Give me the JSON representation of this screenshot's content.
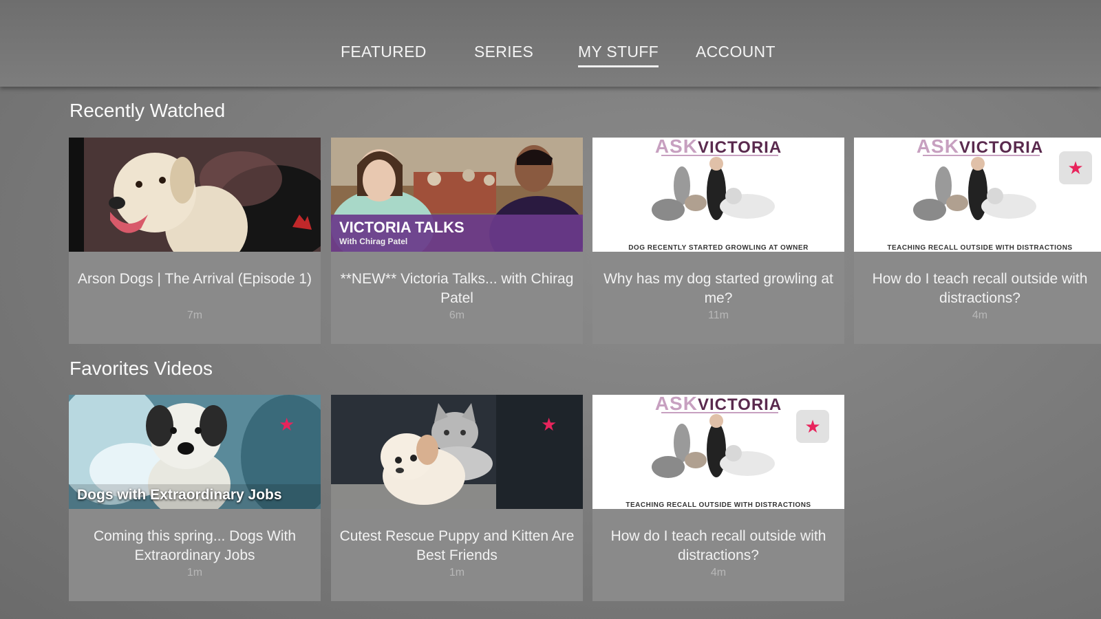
{
  "nav": {
    "tabs": [
      {
        "label": "FEATURED",
        "active": false
      },
      {
        "label": "SERIES",
        "active": false
      },
      {
        "label": "MY STUFF",
        "active": true
      },
      {
        "label": "ACCOUNT",
        "active": false
      }
    ]
  },
  "recently_watched": {
    "title": "Recently Watched",
    "items": [
      {
        "title": "Arson Dogs | The Arrival (Episode 1)",
        "duration": "7m",
        "thumbnail": "labrador-photo"
      },
      {
        "title": "**NEW** Victoria Talks... with Chirag Patel",
        "duration": "6m",
        "thumbnail": "victoria-talks",
        "overlay_title": "VICTORIA TALKS",
        "overlay_subtitle": "With Chirag Patel"
      },
      {
        "title": "Why has my dog started growling at me?",
        "duration": "11m",
        "thumbnail": "ask-victoria",
        "overlay_ask": "ASK",
        "overlay_victoria": "VICTORIA",
        "overlay_caption": "DOG RECENTLY STARTED GROWLING AT OWNER"
      },
      {
        "title": "How do I teach recall outside with distractions?",
        "duration": "4m",
        "thumbnail": "ask-victoria",
        "favorited": true,
        "overlay_ask": "ASK",
        "overlay_victoria": "VICTORIA",
        "overlay_caption": "TEACHING RECALL OUTSIDE WITH DISTRACTIONS"
      }
    ]
  },
  "favorites": {
    "title": "Favorites Videos",
    "items": [
      {
        "title": "Coming this spring... Dogs With Extraordinary Jobs",
        "duration": "1m",
        "thumbnail": "dog-ice-cave",
        "favorited": true,
        "overlay_title": "Dogs with Extraordinary Jobs"
      },
      {
        "title": "Cutest Rescue Puppy and Kitten Are Best Friends",
        "duration": "1m",
        "thumbnail": "puppy-kitten",
        "favorited": true
      },
      {
        "title": "How do I teach recall outside with distractions?",
        "duration": "4m",
        "thumbnail": "ask-victoria",
        "favorited": true,
        "overlay_ask": "ASK",
        "overlay_victoria": "VICTORIA",
        "overlay_caption": "TEACHING RECALL OUTSIDE WITH DISTRACTIONS"
      }
    ]
  },
  "icons": {
    "favorite": "star-icon"
  },
  "colors": {
    "accent_star": "#e8245c",
    "background": "#7a7a7a",
    "card": "#8a8a8a"
  }
}
